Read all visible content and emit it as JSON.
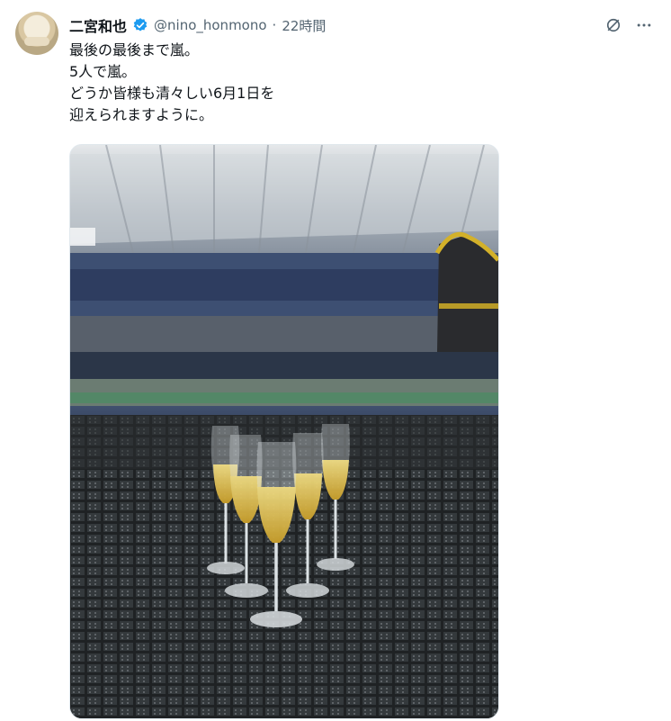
{
  "tweet": {
    "display_name": "二宮和也",
    "handle": "@nino_honmono",
    "separator": "·",
    "time": "22時間",
    "verified_color": "#1d9bf0",
    "text_lines": [
      "最後の最後まで嵐。",
      "5人で嵐。",
      "どうか皆様も清々しい6月1日を",
      "迎えられますように。"
    ]
  },
  "icons": [
    "avatar",
    "verified-badge-icon",
    "grok-icon",
    "more-icon"
  ],
  "media": {
    "description_icon": "champagne-glasses-photo"
  }
}
